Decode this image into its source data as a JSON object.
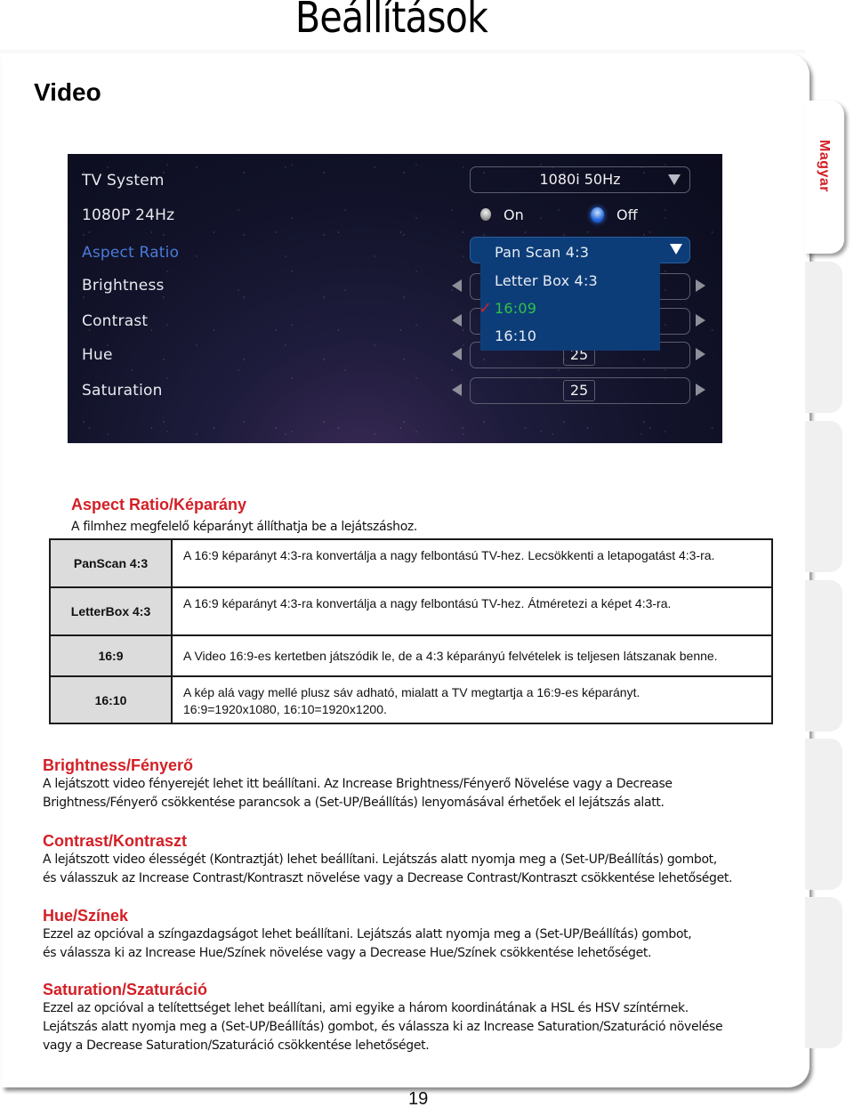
{
  "page_title": "Beállítások",
  "side_tab": {
    "label": "Magyar",
    "color": "#d31f26"
  },
  "section_title": "Video",
  "tv_menu": {
    "rows": [
      {
        "label": "TV System",
        "active": false
      },
      {
        "label": "1080P 24Hz",
        "active": false
      },
      {
        "label": "Aspect Ratio",
        "active": true
      },
      {
        "label": "Brightness",
        "active": false
      },
      {
        "label": "Contrast",
        "active": false
      },
      {
        "label": "Hue",
        "active": false
      },
      {
        "label": "Saturation",
        "active": false
      }
    ],
    "tv_system_value": "1080i 50Hz",
    "radio": {
      "on_label": "On",
      "off_label": "Off",
      "selected": "Off"
    },
    "aspect_dropdown": {
      "options": [
        "Pan Scan 4:3",
        "Letter Box 4:3",
        "16:09",
        "16:10"
      ],
      "selected": "16:09"
    },
    "hue_value": "25",
    "saturation_value": "25"
  },
  "aspect_section": {
    "title": "Aspect Ratio/Képarány",
    "intro": "A filmhez megfelelő képarányt állíthatja be a lejátszáshoz.",
    "table": [
      {
        "name": "PanScan 4:3",
        "desc": [
          "A 16:9 képarányt 4:3-ra konvertálja a nagy felbontású TV-hez. Lecsökkenti a letapogatást 4:3-ra."
        ]
      },
      {
        "name": "LetterBox 4:3",
        "desc": [
          "A 16:9 képarányt 4:3-ra konvertálja a nagy felbontású TV-hez. Átméretezi a képet 4:3-ra."
        ]
      },
      {
        "name": "16:9",
        "desc": [
          "A Video 16:9-es kertetben játszódik le, de a 4:3 képarányú felvételek is teljesen látszanak benne."
        ]
      },
      {
        "name": "16:10",
        "desc": [
          "A kép alá vagy mellé plusz sáv adható, mialatt a TV megtartja a 16:9-es képarányt.",
          "16:9=1920x1080, 16:10=1920x1200."
        ]
      }
    ]
  },
  "brightness_section": {
    "title": "Brightness/Fényerő",
    "lines": [
      "A lejátszott video fényerejét lehet itt beállítani. Az Increase Brightness/Fényerő Növelése vagy a Decrease",
      "Brightness/Fényerő csökkentése parancsok a (Set-UP/Beállítás) lenyomásával érhetőek el lejátszás alatt."
    ]
  },
  "contrast_section": {
    "title": "Contrast/Kontraszt",
    "lines": [
      "A lejátszott video élességét (Kontraztját) lehet beállítani. Lejátszás alatt nyomja meg a (Set-UP/Beállítás) gombot,",
      "és válasszuk az Increase Contrast/Kontraszt növelése vagy a Decrease Contrast/Kontraszt csökkentése lehetőséget."
    ]
  },
  "hue_section": {
    "title": "Hue/Színek",
    "lines": [
      "Ezzel az opcióval a színgazdagságot lehet beállítani. Lejátszás alatt nyomja meg a (Set-UP/Beállítás) gombot,",
      "és válassza ki az Increase Hue/Színek növelése vagy a Decrease Hue/Színek csökkentése lehetőséget."
    ]
  },
  "saturation_section": {
    "title": "Saturation/Szaturáció",
    "lines": [
      "Ezzel az opcióval a telítettséget lehet beállítani, ami egyike a három koordinátának a HSL és HSV színtérnek.",
      "Lejátszás alatt nyomja meg a (Set-UP/Beállítás) gombot, és válassza ki az Increase Saturation/Szaturáció növelése",
      "vagy a Decrease Saturation/Szaturáció csökkentése lehetőséget."
    ]
  },
  "page_number": "19"
}
